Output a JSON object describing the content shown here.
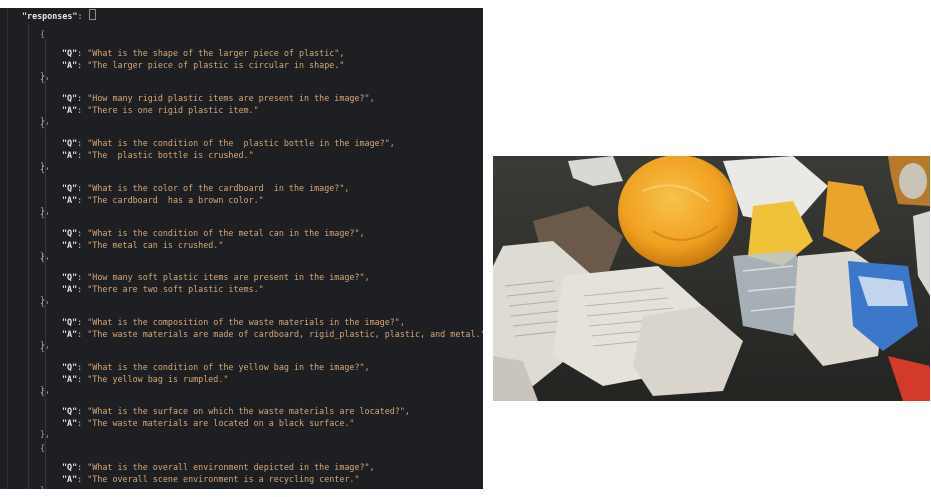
{
  "editor": {
    "key_label": "\"responses\"",
    "q_key": "\"Q\"",
    "a_key": "\"A\"",
    "items": [
      {
        "q": "\"What is the shape of the larger piece of plastic\",",
        "a": "\"The larger piece of plastic is circular in shape.\""
      },
      {
        "q": "\"How many rigid plastic items are present in the image?\",",
        "a": "\"There is one rigid plastic item.\""
      },
      {
        "q": "\"What is the condition of the  plastic bottle in the image?\",",
        "a": "\"The  plastic bottle is crushed.\""
      },
      {
        "q": "\"What is the color of the cardboard  in the image?\",",
        "a": "\"The cardboard  has a brown color.\""
      },
      {
        "q": "\"What is the condition of the metal can in the image?\",",
        "a": "\"The metal can is crushed.\""
      },
      {
        "q": "\"How many soft plastic items are present in the image?\",",
        "a": "\"There are two soft plastic items.\""
      },
      {
        "q": "\"What is the composition of the waste materials in the image?\",",
        "a": "\"The waste materials are made of cardboard, rigid_plastic, plastic, and metal.\""
      },
      {
        "q": "\"What is the condition of the yellow bag in the image?\",",
        "a": "\"The yellow bag is rumpled.\""
      },
      {
        "q": "\"What is the surface on which the waste materials are located?\",",
        "a": "\"The waste materials are located on a black surface.\""
      },
      {
        "q": "\"What is the overall environment depicted in the image?\",",
        "a": "\"The overall scene environment is a recycling center.\""
      }
    ]
  },
  "photo": {
    "subject": "waste-on-conveyor-photo",
    "colors": {
      "belt": "#2d2e2b",
      "yellow_bag": "#f2a72a",
      "paper": "#dcdad4",
      "cardboard": "#c98a2a"
    }
  }
}
